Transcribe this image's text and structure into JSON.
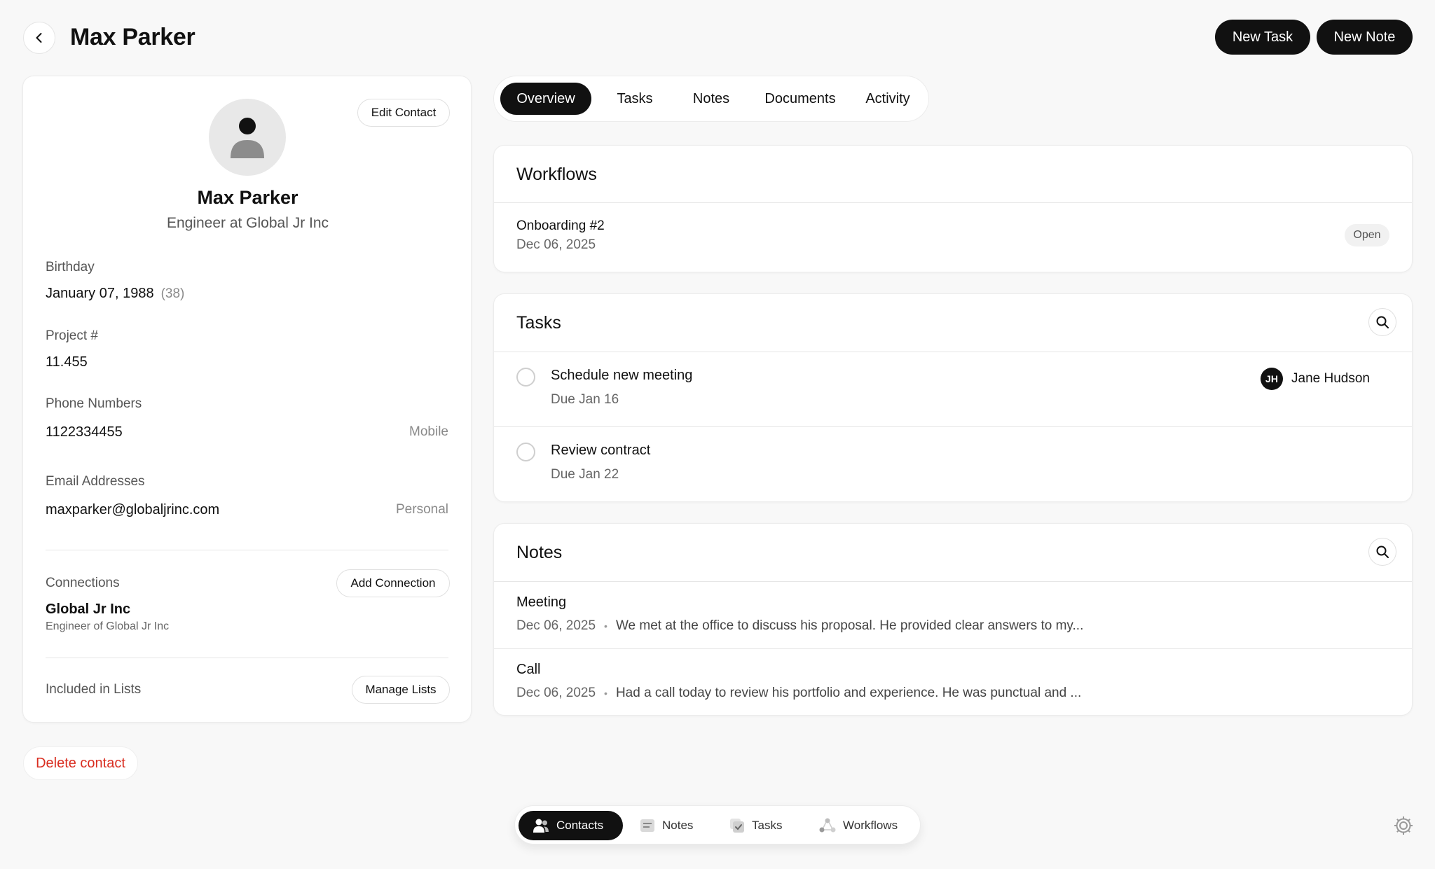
{
  "header": {
    "title": "Max Parker",
    "new_task_label": "New Task",
    "new_note_label": "New Note"
  },
  "contact": {
    "edit_label": "Edit Contact",
    "name": "Max Parker",
    "role": "Engineer at Global Jr Inc",
    "birthday_label": "Birthday",
    "birthday": "January 07, 1988",
    "age": "(38)",
    "project_label": "Project #",
    "project": "11.455",
    "phone_label": "Phone Numbers",
    "phone": "1122334455",
    "phone_type": "Mobile",
    "email_label": "Email Addresses",
    "email": "maxparker@globaljrinc.com",
    "email_type": "Personal",
    "connections_label": "Connections",
    "add_connection_label": "Add Connection",
    "connection_name": "Global Jr Inc",
    "connection_role": "Engineer of Global Jr Inc",
    "lists_label": "Included in Lists",
    "manage_lists_label": "Manage Lists"
  },
  "tabs": [
    "Overview",
    "Tasks",
    "Notes",
    "Documents",
    "Activity"
  ],
  "active_tab": "Overview",
  "workflows": {
    "title": "Workflows",
    "item_name": "Onboarding #2",
    "item_date": "Dec 06, 2025",
    "item_status": "Open"
  },
  "tasks": {
    "title": "Tasks",
    "items": [
      {
        "title": "Schedule new meeting",
        "due": "Due Jan 16",
        "assignee_initials": "JH",
        "assignee": "Jane Hudson"
      },
      {
        "title": "Review contract",
        "due": "Due Jan 22"
      }
    ]
  },
  "notes": {
    "title": "Notes",
    "items": [
      {
        "title": "Meeting",
        "date": "Dec 06, 2025",
        "preview": "We met at the office to discuss his proposal. He provided clear answers to my..."
      },
      {
        "title": "Call",
        "date": "Dec 06, 2025",
        "preview": "Had a call today to review his portfolio and experience. He was punctual and ..."
      }
    ],
    "separator": "•"
  },
  "delete_label": "Delete contact",
  "bottom_nav": {
    "items": [
      "Contacts",
      "Notes",
      "Tasks",
      "Workflows"
    ],
    "active": "Contacts"
  },
  "colors": {
    "accent": "#111111",
    "danger": "#d92d20",
    "background": "#f8f8f8"
  }
}
